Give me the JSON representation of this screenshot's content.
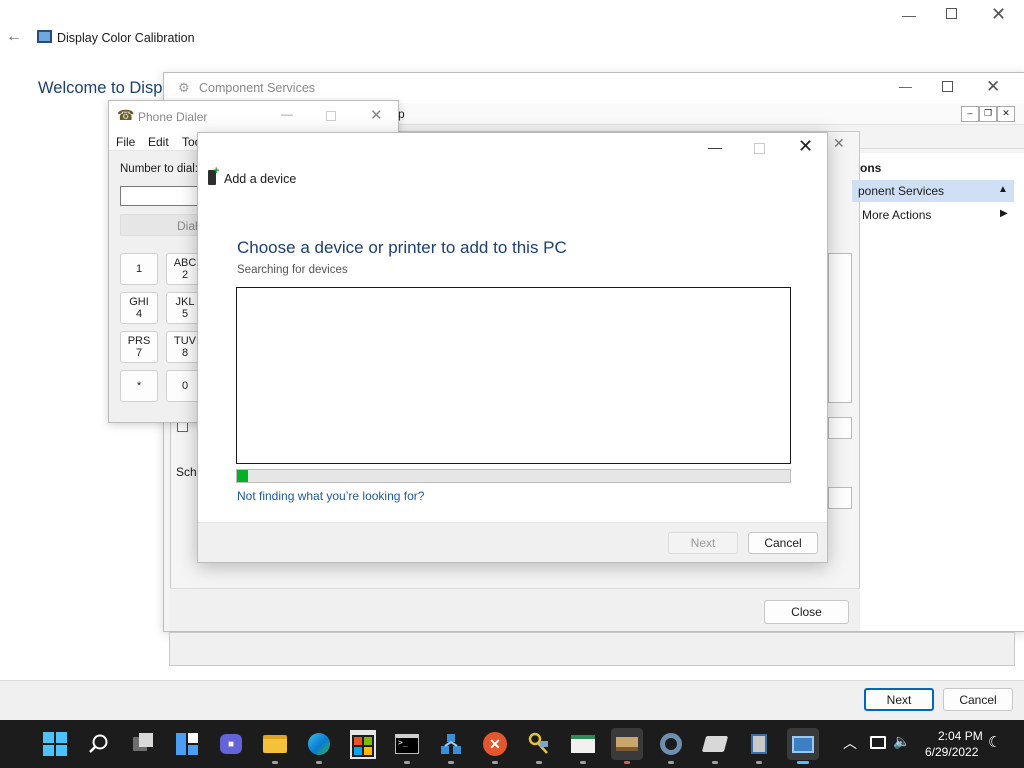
{
  "dcc": {
    "title": "Display Color Calibration",
    "welcome": "Welcome to Display",
    "next_label": "Next",
    "cancel_label": "Cancel"
  },
  "component_services": {
    "title": "Component Services",
    "menu_fragment": "p",
    "actions_header": "ons",
    "actions_item": "ponent Services",
    "more_actions": "More Actions",
    "sche_fragment": "Sche",
    "close_label": "Close"
  },
  "phone_dialer": {
    "title": "Phone Dialer",
    "menu": [
      "File",
      "Edit",
      "Too"
    ],
    "number_label": "Number to dial:",
    "dial_label": "Dial",
    "keys": [
      {
        "top": "",
        "bottom": "1"
      },
      {
        "top": "ABC",
        "bottom": "2"
      },
      {
        "top": "GHI",
        "bottom": "4"
      },
      {
        "top": "JKL",
        "bottom": "5"
      },
      {
        "top": "PRS",
        "bottom": "7"
      },
      {
        "top": "TUV",
        "bottom": "8"
      },
      {
        "top": "",
        "bottom": "*"
      },
      {
        "top": "",
        "bottom": "0"
      }
    ]
  },
  "add_device": {
    "title": "Add a device",
    "heading": "Choose a device or printer to add to this PC",
    "subheading": "Searching for devices",
    "progress": 0.02,
    "help_link": "Not finding what you’re looking for?",
    "next_label": "Next",
    "cancel_label": "Cancel"
  },
  "taskbar": {
    "icons": [
      "windows-start-icon",
      "search-icon",
      "task-view-icon",
      "widgets-icon",
      "chat-icon",
      "file-explorer-icon",
      "edge-icon",
      "store-icon",
      "terminal-icon",
      "network-icon",
      "x-app-icon",
      "key-app-icon",
      "document-app-icon",
      "books-app-icon",
      "settings-icon",
      "drive-app-icon",
      "server-app-icon",
      "color-calibration-icon"
    ],
    "time": "2:04 PM",
    "date": "6/29/2022"
  },
  "colors": {
    "accent": "#0067c0",
    "heading_blue": "#1e3f73",
    "link": "#1a5a9e",
    "progress": "#06b025",
    "taskbar": "#1c1c1c"
  }
}
